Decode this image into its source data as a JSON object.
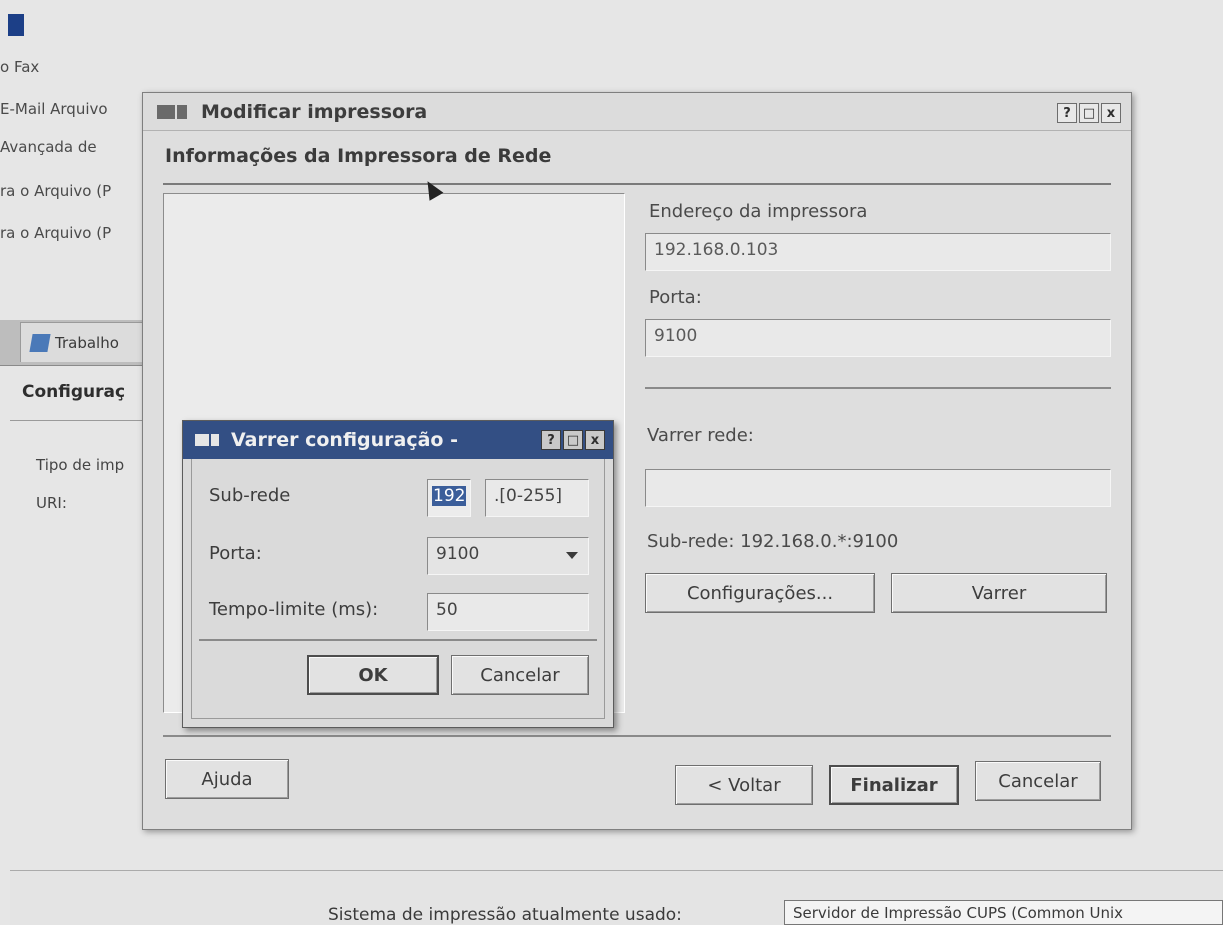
{
  "background": {
    "menu_items": [
      "o Fax",
      "E-Mail Arquivo",
      "Avançada de",
      "ra o Arquivo (P",
      "ra o Arquivo (P"
    ],
    "tab_label": "Trabalho",
    "section_title": "Configuraç",
    "labels": [
      "Tipo de imp",
      "URI:"
    ],
    "status_text": "Sistema de impressão atualmente usado:",
    "status_value": "Servidor de Impressão CUPS (Common Unix"
  },
  "main_dialog": {
    "title": "Modificar impressora",
    "subtitle": "Informações da Impressora de Rede",
    "title_buttons": [
      "?",
      "□",
      "x"
    ],
    "address_label": "Endereço da impressora",
    "address_value": "192.168.0.103",
    "port_label": "Porta:",
    "port_value": "9100",
    "scan_label": "Varrer rede:",
    "scan_value": "",
    "subnet_info": "Sub-rede: 192.168.0.*:9100",
    "settings_button": "Configurações...",
    "scan_button": "Varrer",
    "help_button": "Ajuda",
    "back_button": "< Voltar",
    "finish_button": "Finalizar",
    "cancel_button": "Cancelar"
  },
  "scan_dialog": {
    "title": "Varrer configuração -",
    "title_buttons": [
      "?",
      "□",
      "x"
    ],
    "subnet_label": "Sub-rede",
    "subnet_value": "192",
    "subnet_range": ".[0-255]",
    "port_label": "Porta:",
    "port_value": "9100",
    "timeout_label": "Tempo-limite (ms):",
    "timeout_value": "50",
    "ok_button": "OK",
    "cancel_button": "Cancelar"
  }
}
